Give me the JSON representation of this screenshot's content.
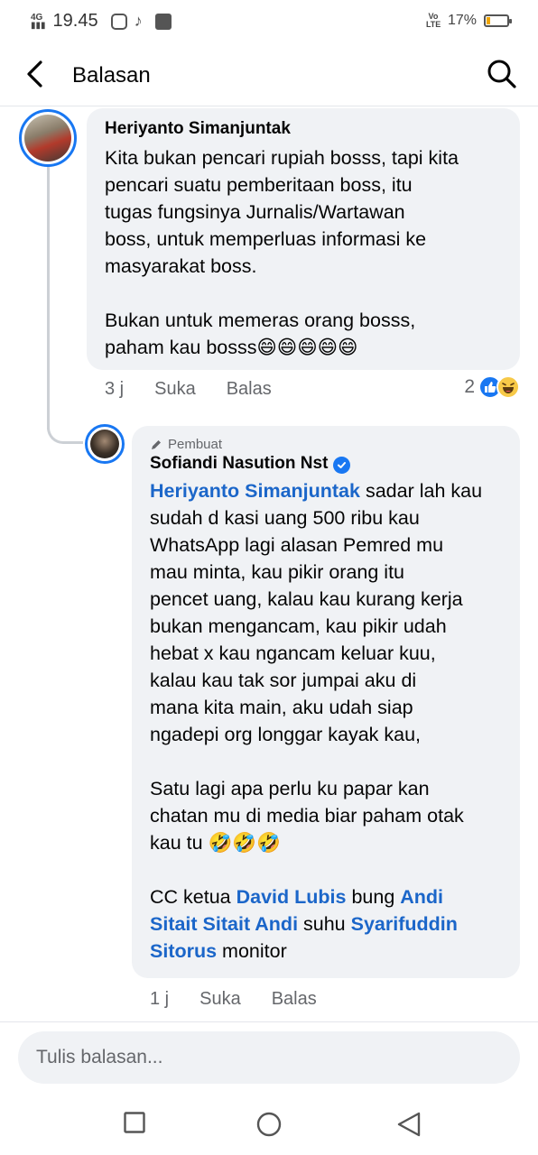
{
  "status_bar": {
    "network": "4G",
    "time": "19.45",
    "volte": "Vo LTE",
    "battery": "17%",
    "battery_level": 0.17
  },
  "header": {
    "title": "Balasan"
  },
  "comments": [
    {
      "author": "Heriyanto Simanjuntak",
      "text": "Kita bukan pencari rupiah bosss, tapi kita\npencari suatu pemberitaan boss, itu\ntugas fungsinya Jurnalis/Wartawan\nboss, untuk memperluas informasi ke\nmasyarakat boss.\n\nBukan untuk memeras orang bosss,\npaham kau bosss😄😄😄😄😄",
      "time": "3 j",
      "like_label": "Suka",
      "reply_label": "Balas",
      "reaction_count": "2"
    },
    {
      "badge": "Pembuat",
      "author": "Sofiandi Nasution Nst",
      "mention_1": "Heriyanto Simanjuntak",
      "text_1": " sadar lah kau\nsudah d kasi uang 500 ribu kau\nWhatsApp lagi alasan Pemred mu\nmau minta, kau pikir orang itu\npencet uang, kalau kau kurang kerja\nbukan mengancam, kau pikir udah\nhebat x kau ngancam keluar kuu,\nkalau kau tak sor jumpai aku di\nmana kita main, aku udah siap\nngadepi org longgar kayak kau,\n\nSatu lagi apa perlu ku papar kan\nchatan mu di media biar paham otak\nkau tu 🤣🤣🤣\n\nCC ketua ",
      "mention_2": "David Lubis",
      "text_2": " bung ",
      "mention_3": "Andi\nSitait Sitait Andi",
      "text_3": " suhu ",
      "mention_4": "Syarifuddin\nSitorus",
      "text_4": " monitor",
      "time": "1 j",
      "like_label": "Suka",
      "reply_label": "Balas"
    }
  ],
  "composer": {
    "placeholder": "Tulis balasan..."
  },
  "colors": {
    "accent": "#1877f2",
    "mention": "#1b66c9",
    "bubble": "#f0f2f5",
    "meta": "#65676b"
  }
}
